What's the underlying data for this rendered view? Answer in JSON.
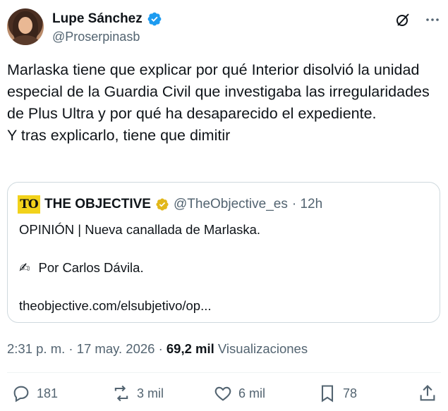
{
  "author": {
    "name": "Lupe Sánchez",
    "handle": "@Proserpinasb"
  },
  "tweet": {
    "lines": [
      "Marlaska tiene que explicar por qué Interior disolvió la unidad especial de la Guardia Civil que investigaba las irregularidades de Plus Ultra y por qué ha desaparecido el expediente.",
      "Y tras explicarlo, tiene que dimitir"
    ]
  },
  "quote": {
    "logo_text": "TO",
    "name": "THE OBJECTIVE",
    "handle": "@TheObjective_es",
    "time": "· 12h",
    "line1": "OPINIÓN | Nueva canallada de Marlaska.",
    "byline_emoji": "✍",
    "byline": "Por Carlos Dávila.",
    "link": "theobjective.com/elsubjetivo/op..."
  },
  "meta": {
    "time": "2:31 p. m. · 17 may. 2026 ·",
    "views_count": "69,2 mil",
    "views_label": "Visualizaciones"
  },
  "actions": {
    "replies": "181",
    "reposts": "3 mil",
    "likes": "6 mil",
    "bookmarks": "78"
  },
  "colors": {
    "verified": "#1d9bf0",
    "gold_badge": "#e2b719",
    "muted": "#536471",
    "logo_bg": "#f2d21b"
  },
  "icons": [
    "verified-icon",
    "grok-icon",
    "more-icon",
    "reply-icon",
    "repost-icon",
    "like-icon",
    "bookmark-icon",
    "share-icon"
  ]
}
